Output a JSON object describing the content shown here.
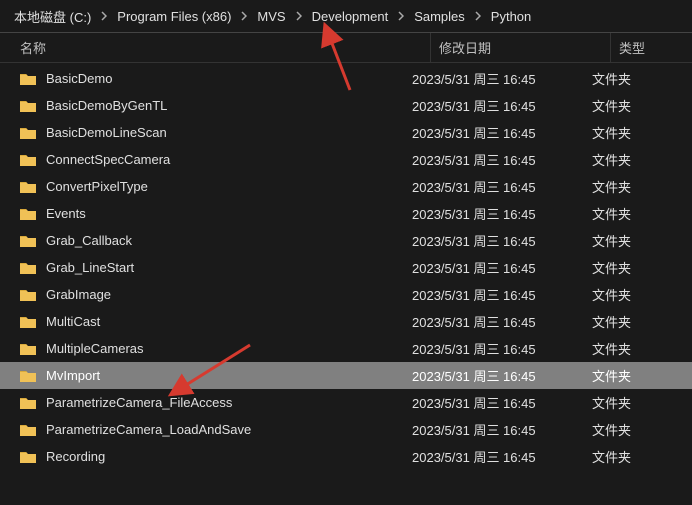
{
  "breadcrumb": [
    {
      "label": "本地磁盘 (C:)"
    },
    {
      "label": "Program Files (x86)"
    },
    {
      "label": "MVS"
    },
    {
      "label": "Development"
    },
    {
      "label": "Samples"
    },
    {
      "label": "Python"
    }
  ],
  "header": {
    "name": "名称",
    "date": "修改日期",
    "type": "类型"
  },
  "rows": [
    {
      "name": "BasicDemo",
      "date": "2023/5/31 周三 16:45",
      "type": "文件夹",
      "selected": false
    },
    {
      "name": "BasicDemoByGenTL",
      "date": "2023/5/31 周三 16:45",
      "type": "文件夹",
      "selected": false
    },
    {
      "name": "BasicDemoLineScan",
      "date": "2023/5/31 周三 16:45",
      "type": "文件夹",
      "selected": false
    },
    {
      "name": "ConnectSpecCamera",
      "date": "2023/5/31 周三 16:45",
      "type": "文件夹",
      "selected": false
    },
    {
      "name": "ConvertPixelType",
      "date": "2023/5/31 周三 16:45",
      "type": "文件夹",
      "selected": false
    },
    {
      "name": "Events",
      "date": "2023/5/31 周三 16:45",
      "type": "文件夹",
      "selected": false
    },
    {
      "name": "Grab_Callback",
      "date": "2023/5/31 周三 16:45",
      "type": "文件夹",
      "selected": false
    },
    {
      "name": "Grab_LineStart",
      "date": "2023/5/31 周三 16:45",
      "type": "文件夹",
      "selected": false
    },
    {
      "name": "GrabImage",
      "date": "2023/5/31 周三 16:45",
      "type": "文件夹",
      "selected": false
    },
    {
      "name": "MultiCast",
      "date": "2023/5/31 周三 16:45",
      "type": "文件夹",
      "selected": false
    },
    {
      "name": "MultipleCameras",
      "date": "2023/5/31 周三 16:45",
      "type": "文件夹",
      "selected": false
    },
    {
      "name": "MvImport",
      "date": "2023/5/31 周三 16:45",
      "type": "文件夹",
      "selected": true
    },
    {
      "name": "ParametrizeCamera_FileAccess",
      "date": "2023/5/31 周三 16:45",
      "type": "文件夹",
      "selected": false
    },
    {
      "name": "ParametrizeCamera_LoadAndSave",
      "date": "2023/5/31 周三 16:45",
      "type": "文件夹",
      "selected": false
    },
    {
      "name": "Recording",
      "date": "2023/5/31 周三 16:45",
      "type": "文件夹",
      "selected": false
    }
  ],
  "colors": {
    "arrow": "#d63a2f",
    "folder": "#f0c156"
  }
}
